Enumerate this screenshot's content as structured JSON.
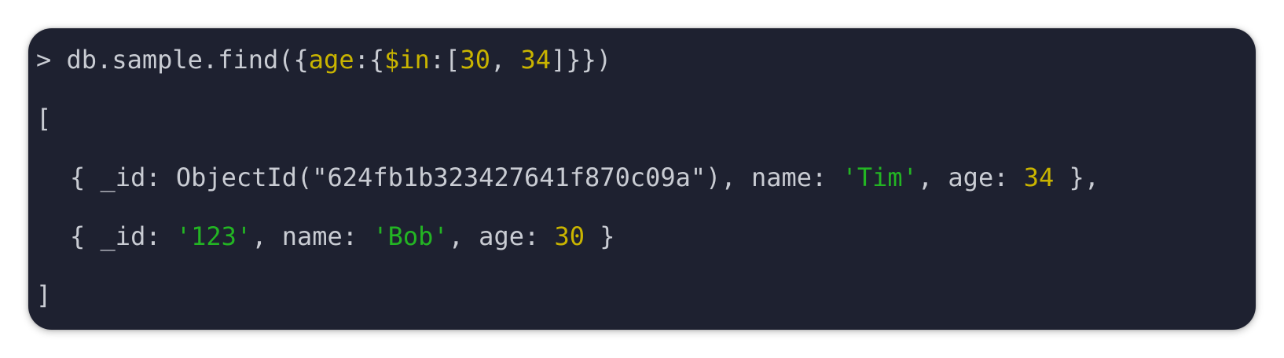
{
  "colors": {
    "background": "#1e2130",
    "text": "#c9ccd3",
    "number": "#c9b400",
    "string": "#23b523"
  },
  "terminal": {
    "command": {
      "prompt": ">",
      "pre": " db.sample.find({",
      "field": "age",
      "colon": ":{",
      "operator": "$in",
      "colon2": ":[",
      "value1": "30",
      "sep": ", ",
      "value2": "34",
      "post": "]}})"
    },
    "open_bracket": "[",
    "rows": [
      {
        "pre": "{ _id: ",
        "id": "ObjectId(\"624fb1b323427641f870c09a\")",
        "name_label": ", name: ",
        "name": "'Tim'",
        "age_label": ", age: ",
        "age": "34",
        "post": " },"
      },
      {
        "pre": "{ _id: ",
        "id": "'123'",
        "name_label": ", name: ",
        "name": "'Bob'",
        "age_label": ", age: ",
        "age": "30",
        "post": " }"
      }
    ],
    "close_bracket": "]"
  }
}
